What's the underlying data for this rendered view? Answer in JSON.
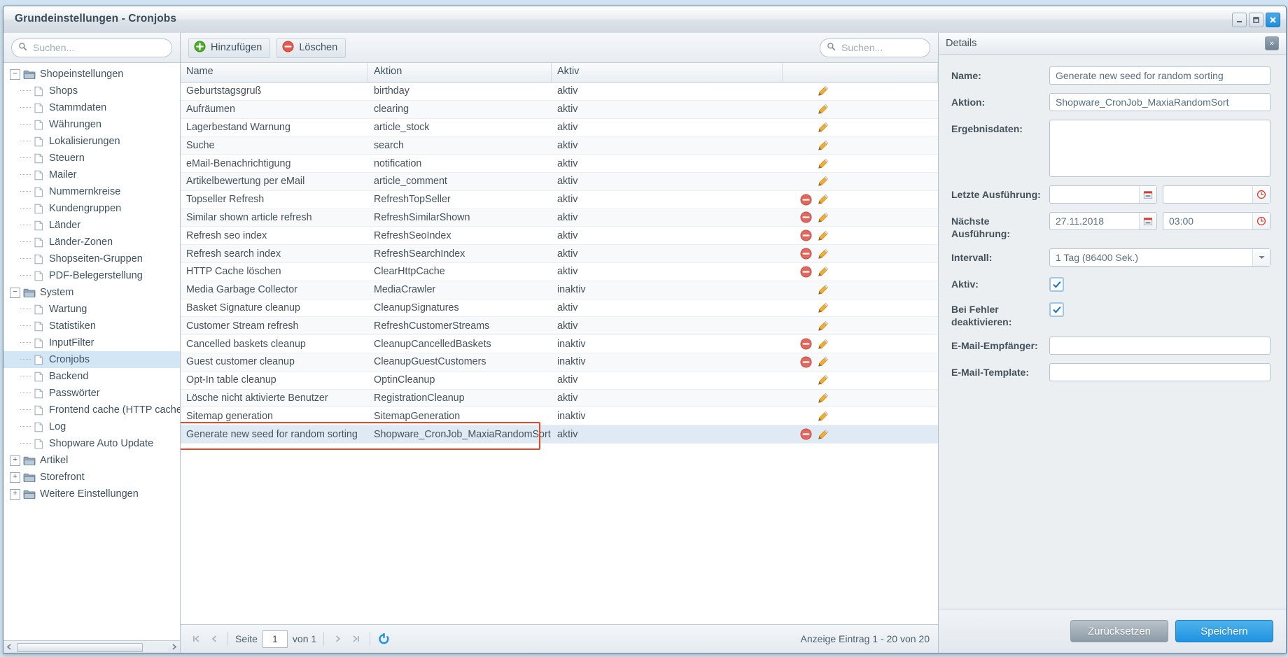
{
  "window": {
    "title": "Grundeinstellungen - Cronjobs",
    "controls": [
      {
        "name": "minimize-button",
        "glyph": "minimize"
      },
      {
        "name": "maximize-button",
        "glyph": "maximize"
      },
      {
        "name": "close-button",
        "glyph": "close"
      }
    ]
  },
  "sidebar": {
    "search_placeholder": "Suchen...",
    "items": [
      {
        "label": "Shopeinstellungen",
        "type": "folder",
        "depth": 0,
        "expanded": true,
        "selected": false
      },
      {
        "label": "Shops",
        "type": "file",
        "depth": 1,
        "selected": false
      },
      {
        "label": "Stammdaten",
        "type": "file",
        "depth": 1,
        "selected": false
      },
      {
        "label": "Währungen",
        "type": "file",
        "depth": 1,
        "selected": false
      },
      {
        "label": "Lokalisierungen",
        "type": "file",
        "depth": 1,
        "selected": false
      },
      {
        "label": "Steuern",
        "type": "file",
        "depth": 1,
        "selected": false
      },
      {
        "label": "Mailer",
        "type": "file",
        "depth": 1,
        "selected": false
      },
      {
        "label": "Nummernkreise",
        "type": "file",
        "depth": 1,
        "selected": false
      },
      {
        "label": "Kundengruppen",
        "type": "file",
        "depth": 1,
        "selected": false
      },
      {
        "label": "Länder",
        "type": "file",
        "depth": 1,
        "selected": false
      },
      {
        "label": "Länder-Zonen",
        "type": "file",
        "depth": 1,
        "selected": false
      },
      {
        "label": "Shopseiten-Gruppen",
        "type": "file",
        "depth": 1,
        "selected": false
      },
      {
        "label": "PDF-Belegerstellung",
        "type": "file",
        "depth": 1,
        "selected": false
      },
      {
        "label": "System",
        "type": "folder",
        "depth": 0,
        "expanded": true,
        "selected": false
      },
      {
        "label": "Wartung",
        "type": "file",
        "depth": 1,
        "selected": false
      },
      {
        "label": "Statistiken",
        "type": "file",
        "depth": 1,
        "selected": false
      },
      {
        "label": "InputFilter",
        "type": "file",
        "depth": 1,
        "selected": false
      },
      {
        "label": "Cronjobs",
        "type": "file",
        "depth": 1,
        "selected": true
      },
      {
        "label": "Backend",
        "type": "file",
        "depth": 1,
        "selected": false
      },
      {
        "label": "Passwörter",
        "type": "file",
        "depth": 1,
        "selected": false
      },
      {
        "label": "Frontend cache (HTTP cache)",
        "type": "file",
        "depth": 1,
        "selected": false
      },
      {
        "label": "Log",
        "type": "file",
        "depth": 1,
        "selected": false
      },
      {
        "label": "Shopware Auto Update",
        "type": "file",
        "depth": 1,
        "selected": false
      },
      {
        "label": "Artikel",
        "type": "folder",
        "depth": 0,
        "expanded": false,
        "selected": false
      },
      {
        "label": "Storefront",
        "type": "folder",
        "depth": 0,
        "expanded": false,
        "selected": false
      },
      {
        "label": "Weitere Einstellungen",
        "type": "folder",
        "depth": 0,
        "expanded": false,
        "selected": false
      }
    ]
  },
  "toolbar": {
    "add_label": "Hinzufügen",
    "delete_label": "Löschen",
    "search_placeholder": "Suchen...",
    "search_value": ""
  },
  "grid": {
    "columns": [
      "Name",
      "Aktion",
      "Aktiv",
      ""
    ],
    "rows": [
      {
        "name": "Geburtstagsgruß",
        "action": "birthday",
        "active": "aktiv",
        "can_delete": false
      },
      {
        "name": "Aufräumen",
        "action": "clearing",
        "active": "aktiv",
        "can_delete": false
      },
      {
        "name": "Lagerbestand Warnung",
        "action": "article_stock",
        "active": "aktiv",
        "can_delete": false
      },
      {
        "name": "Suche",
        "action": "search",
        "active": "aktiv",
        "can_delete": false
      },
      {
        "name": "eMail-Benachrichtigung",
        "action": "notification",
        "active": "aktiv",
        "can_delete": false
      },
      {
        "name": "Artikelbewertung per eMail",
        "action": "article_comment",
        "active": "aktiv",
        "can_delete": false
      },
      {
        "name": "Topseller Refresh",
        "action": "RefreshTopSeller",
        "active": "aktiv",
        "can_delete": true
      },
      {
        "name": "Similar shown article refresh",
        "action": "RefreshSimilarShown",
        "active": "aktiv",
        "can_delete": true
      },
      {
        "name": "Refresh seo index",
        "action": "RefreshSeoIndex",
        "active": "aktiv",
        "can_delete": true
      },
      {
        "name": "Refresh search index",
        "action": "RefreshSearchIndex",
        "active": "aktiv",
        "can_delete": true
      },
      {
        "name": "HTTP Cache löschen",
        "action": "ClearHttpCache",
        "active": "aktiv",
        "can_delete": true
      },
      {
        "name": "Media Garbage Collector",
        "action": "MediaCrawler",
        "active": "inaktiv",
        "can_delete": false
      },
      {
        "name": "Basket Signature cleanup",
        "action": "CleanupSignatures",
        "active": "aktiv",
        "can_delete": false
      },
      {
        "name": "Customer Stream refresh",
        "action": "RefreshCustomerStreams",
        "active": "aktiv",
        "can_delete": false
      },
      {
        "name": "Cancelled baskets cleanup",
        "action": "CleanupCancelledBaskets",
        "active": "inaktiv",
        "can_delete": true
      },
      {
        "name": "Guest customer cleanup",
        "action": "CleanupGuestCustomers",
        "active": "inaktiv",
        "can_delete": true
      },
      {
        "name": "Opt-In table cleanup",
        "action": "OptinCleanup",
        "active": "aktiv",
        "can_delete": false
      },
      {
        "name": "Lösche nicht aktivierte Benutzer",
        "action": "RegistrationCleanup",
        "active": "aktiv",
        "can_delete": false
      },
      {
        "name": "Sitemap generation",
        "action": "SitemapGeneration",
        "active": "inaktiv",
        "can_delete": false
      },
      {
        "name": "Generate new seed for random sorting",
        "action": "Shopware_CronJob_MaxiaRandomSort",
        "active": "aktiv",
        "can_delete": true,
        "highlighted": true
      }
    ]
  },
  "pager": {
    "page_label": "Seite",
    "page_value": "1",
    "of_label": "von 1",
    "status": "Anzeige Eintrag 1 - 20 von 20"
  },
  "details": {
    "header": "Details",
    "collapse_glyph": "»",
    "fields": {
      "name_label": "Name:",
      "name_value": "Generate new seed for random sorting",
      "action_label": "Aktion:",
      "action_value": "Shopware_CronJob_MaxiaRandomSort",
      "result_label": "Ergebnisdaten:",
      "result_value": "",
      "last_run_label": "Letzte Ausführung:",
      "last_run_date": "",
      "last_run_time": "",
      "next_run_label": "Nächste Ausführung:",
      "next_run_date": "27.11.2018",
      "next_run_time": "03:00",
      "interval_label": "Intervall:",
      "interval_value": "1 Tag (86400 Sek.)",
      "active_label": "Aktiv:",
      "active_checked": true,
      "disable_on_error_label": "Bei Fehler deaktivieren:",
      "disable_on_error_checked": true,
      "email_recipient_label": "E-Mail-Empfänger:",
      "email_recipient_value": "",
      "email_template_label": "E-Mail-Template:",
      "email_template_value": ""
    },
    "reset_label": "Zurücksetzen",
    "save_label": "Speichern"
  },
  "colors": {
    "accent": "#1f92e0",
    "danger": "#e8472a",
    "selection": "#d3e6f5",
    "highlight_row": "#dfeaf5"
  }
}
